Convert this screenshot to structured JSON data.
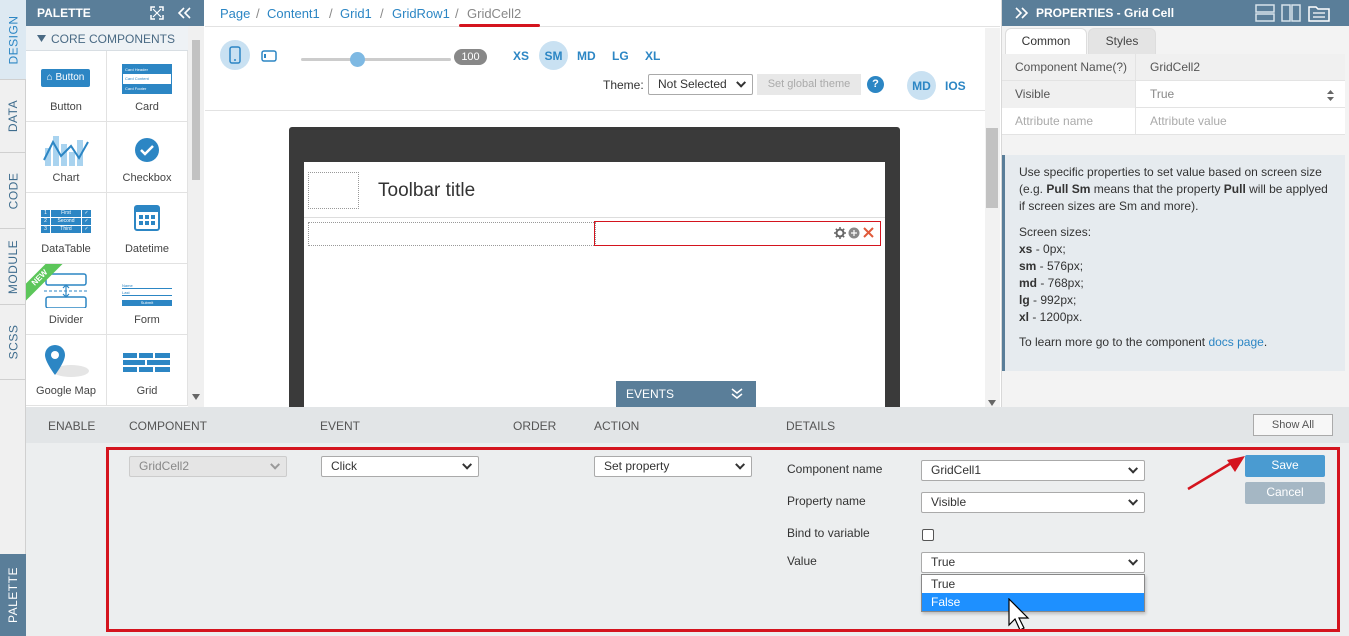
{
  "side_tabs": {
    "design": "DESIGN",
    "data": "DATA",
    "code": "CODE",
    "module": "MODULE",
    "scss": "SCSS",
    "palette": "PALETTE"
  },
  "palette": {
    "title": "PALETTE",
    "section": "CORE COMPONENTS",
    "new_ribbon": "NEW",
    "items": [
      {
        "label": "Button",
        "icon": "button-icon"
      },
      {
        "label": "Card",
        "icon": "card-icon"
      },
      {
        "label": "Chart",
        "icon": "chart-icon"
      },
      {
        "label": "Checkbox",
        "icon": "checkbox-icon"
      },
      {
        "label": "DataTable",
        "icon": "datatable-icon"
      },
      {
        "label": "Datetime",
        "icon": "calendar-icon"
      },
      {
        "label": "Divider",
        "icon": "divider-icon"
      },
      {
        "label": "Form",
        "icon": "form-icon"
      },
      {
        "label": "Google Map",
        "icon": "map-pin-icon"
      },
      {
        "label": "Grid",
        "icon": "grid-icon"
      }
    ],
    "button_icon_text": "Button",
    "card_icon_rows": [
      "Card Header",
      "Card Content",
      "Card Footer"
    ],
    "datatable_icon_rows": [
      [
        "1",
        "First"
      ],
      [
        "2",
        "Second"
      ],
      [
        "3",
        "Third"
      ]
    ],
    "form_icon_rows": [
      "Name",
      "Last",
      "Submit"
    ]
  },
  "breadcrumb": [
    "Page",
    "Content1",
    "Grid1",
    "GridRow1",
    "GridCell2"
  ],
  "toolbar": {
    "zoom": "100",
    "sizes": [
      "XS",
      "SM",
      "MD",
      "LG",
      "XL"
    ],
    "active_size": "SM",
    "theme_label": "Theme:",
    "theme_value": "Not Selected",
    "global_theme_btn": "Set global theme",
    "help": "?",
    "platform_md": "MD",
    "platform_ios": "IOS"
  },
  "canvas": {
    "toolbar_title": "Toolbar title",
    "events_tab": "EVENTS"
  },
  "properties": {
    "title": "PROPERTIES - Grid Cell",
    "tabs": [
      "Common",
      "Styles"
    ],
    "rows": [
      {
        "key": "Component Name(?)",
        "value": "GridCell2"
      },
      {
        "key": "Visible",
        "value": "True"
      }
    ],
    "attr_placeholder_name": "Attribute name",
    "attr_placeholder_value": "Attribute value",
    "info_line1_a": "Use specific properties to set value based on screen size (e.g. ",
    "info_line1_b": "Pull Sm",
    "info_line1_c": " means that the property ",
    "info_line1_d": "Pull",
    "info_line1_e": " will be applyed if screen sizes are Sm and more).",
    "screen_sizes_title": "Screen sizes:",
    "screen_sizes": [
      {
        "k": "xs",
        "v": " - 0px;"
      },
      {
        "k": "sm",
        "v": " - 576px;"
      },
      {
        "k": "md",
        "v": " - 768px;"
      },
      {
        "k": "lg",
        "v": " - 992px;"
      },
      {
        "k": "xl",
        "v": " - 1200px."
      }
    ],
    "docs_text": "To learn more go to the component ",
    "docs_link": "docs page",
    "docs_end": "."
  },
  "events": {
    "columns": [
      "ENABLE",
      "COMPONENT",
      "EVENT",
      "ORDER",
      "ACTION",
      "DETAILS"
    ],
    "show_all": "Show All",
    "component": "GridCell2",
    "event": "Click",
    "action": "Set property",
    "details": {
      "component_name_label": "Component name",
      "component_name_value": "GridCell1",
      "property_name_label": "Property name",
      "property_name_value": "Visible",
      "bind_label": "Bind to variable",
      "value_label": "Value",
      "value_value": "True",
      "options": [
        "True",
        "False"
      ],
      "highlighted_option": "False"
    },
    "save": "Save",
    "cancel": "Cancel"
  },
  "colors": {
    "accent": "#2c86c4",
    "header": "#5a7e99",
    "highlight_red": "#d4141e",
    "selected_option": "#1e90ff"
  }
}
